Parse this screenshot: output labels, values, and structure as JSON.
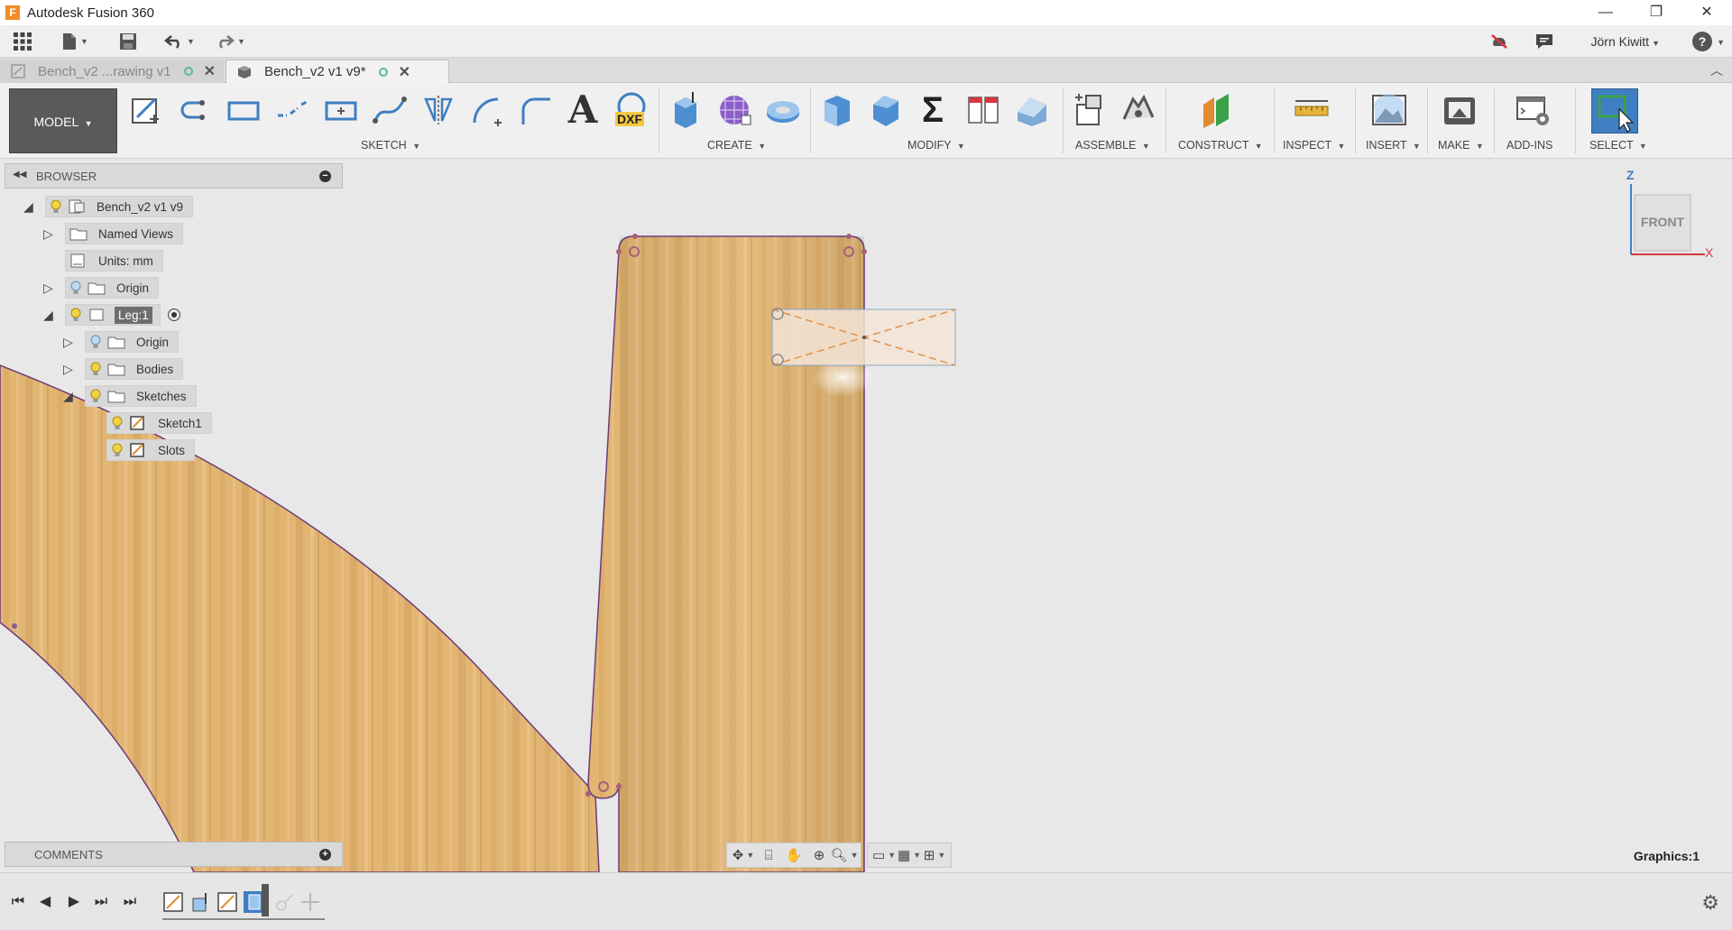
{
  "window": {
    "title": "Autodesk Fusion 360",
    "app_icon_letter": "F",
    "controls": [
      "—",
      "❐",
      "✕"
    ]
  },
  "quick_access": {
    "user_name": "Jörn Kiwitt",
    "help": "?"
  },
  "tabs": [
    {
      "label": "Bench_v2 ...rawing v1",
      "active": false
    },
    {
      "label": "Bench_v2 v1 v9*",
      "active": true
    }
  ],
  "ribbon": {
    "workspace": "MODEL",
    "groups": [
      "SKETCH",
      "CREATE",
      "MODIFY",
      "ASSEMBLE",
      "CONSTRUCT",
      "INSPECT",
      "INSERT",
      "MAKE",
      "ADD-INS",
      "SELECT"
    ],
    "tool_icons": {
      "sketch": [
        "create-sketch-icon",
        "project-icon",
        "rectangle-icon",
        "line-icon",
        "rectangle-center-icon",
        "spline-icon",
        "mirror-icon",
        "arc-icon",
        "fillet-icon",
        "text-icon",
        "dxf-icon"
      ],
      "create": [
        "extrude-icon",
        "form-icon",
        "revolve-icon"
      ],
      "modify": [
        "press-pull-icon",
        "shell-icon",
        "parameters-icon",
        "split-body-icon",
        "chamfer-icon"
      ],
      "assemble": [
        "new-component-icon",
        "joint-icon"
      ],
      "construct": [
        "offset-plane-icon"
      ],
      "inspect": [
        "measure-icon"
      ],
      "insert": [
        "insert-image-icon"
      ],
      "make": [
        "3d-print-icon"
      ],
      "addins": [
        "scripts-icon"
      ],
      "select": [
        "select-icon"
      ]
    },
    "dxf_text": "DXF",
    "text_tool": "A",
    "sum_tool": "Σ"
  },
  "browser": {
    "title": "BROWSER",
    "items": [
      {
        "label": "Bench_v2 v1 v9",
        "level": 0,
        "expanded": true
      },
      {
        "label": "Named Views",
        "level": 1,
        "expanded": false
      },
      {
        "label": "Units: mm",
        "level": 1
      },
      {
        "label": "Origin",
        "level": 1,
        "expanded": false
      },
      {
        "label": "Leg:1",
        "level": 1,
        "expanded": true,
        "highlighted": true
      },
      {
        "label": "Origin",
        "level": 2,
        "expanded": false
      },
      {
        "label": "Bodies",
        "level": 2,
        "expanded": false
      },
      {
        "label": "Sketches",
        "level": 2,
        "expanded": true
      },
      {
        "label": "Sketch1",
        "level": 3
      },
      {
        "label": "Slots",
        "level": 3
      }
    ]
  },
  "comments": {
    "title": "COMMENTS"
  },
  "viewcube": {
    "face": "FRONT",
    "axis_z": "Z",
    "axis_x": "X"
  },
  "graphics_label": "Graphics:1",
  "colors": {
    "wood_light": "#e6bd7a",
    "wood_dark": "#c89a55",
    "sketch_line": "#6b3c7a",
    "accent_blue": "#3f7fc1",
    "select_green": "#3aa34a"
  }
}
